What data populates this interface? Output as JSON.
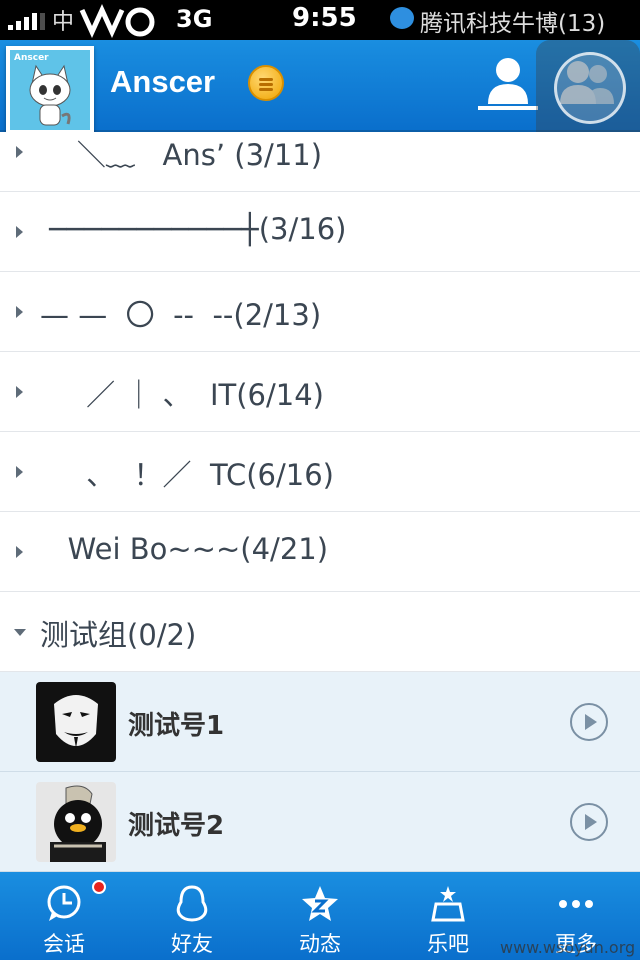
{
  "status_bar": {
    "carrier": "中",
    "network": "3G",
    "time": "9:55",
    "notification": "腾讯科技牛博(13)"
  },
  "header": {
    "avatar_text": "Anscer",
    "username": "Anscer",
    "active_tab_icon": "contacts-icon",
    "second_tab_icon": "groups-icon"
  },
  "groups": [
    {
      "label": "    ＼﹏   Ans’ (3/11)",
      "expanded": false
    },
    {
      "label": " ───────────┼(3/16)",
      "expanded": false
    },
    {
      "label": "— —  〇  --  --(2/13)",
      "expanded": false
    },
    {
      "label": "     ／ ｜ 、  IT(6/14)",
      "expanded": false
    },
    {
      "label": "     、  ！／  TC(6/16)",
      "expanded": false
    },
    {
      "label": "   Wei Bo~~~(4/21)",
      "expanded": false
    },
    {
      "label": "测试组(0/2)",
      "expanded": true
    }
  ],
  "contacts": [
    {
      "name": "测试号1",
      "avatar": "mask-avatar"
    },
    {
      "name": "测试号2",
      "avatar": "penguin-avatar"
    }
  ],
  "tabbar": {
    "items": [
      {
        "label": "会话",
        "icon": "chat-clock-icon",
        "badge": true
      },
      {
        "label": "好友",
        "icon": "penguin-icon",
        "badge": false
      },
      {
        "label": "动态",
        "icon": "star-z-icon",
        "badge": false
      },
      {
        "label": "乐吧",
        "icon": "leba-icon",
        "badge": false
      },
      {
        "label": "更多",
        "icon": "more-dots-icon",
        "badge": false
      }
    ]
  },
  "watermark": "www.wsoyun.org",
  "colors": {
    "header_blue": "#0a6fcc",
    "contact_bg": "#e8f2f9",
    "badge_red": "#e8231e"
  }
}
